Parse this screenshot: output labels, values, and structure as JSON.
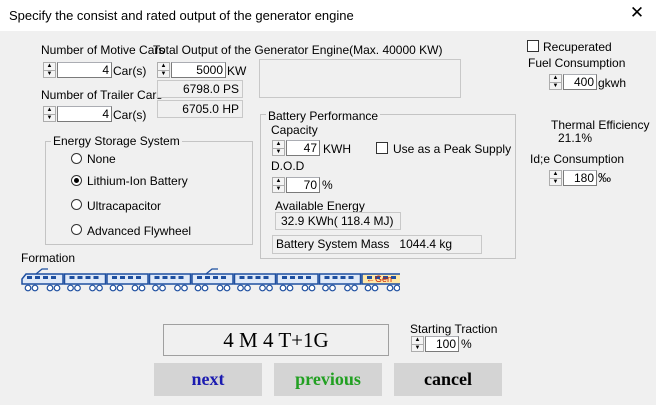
{
  "window": {
    "title": "Specify the consist and rated output of the generator engine",
    "close_glyph": "✕"
  },
  "motive": {
    "label": "Number of Motive Cars",
    "value": "4",
    "unit": "Car(s)"
  },
  "trailer": {
    "label": "Number of Trailer Cars",
    "value": "4",
    "unit": "Car(s)"
  },
  "output": {
    "label": "Total Output of the Generator Engine(Max. 40000 KW)",
    "value": "5000",
    "unit": "KW",
    "ps": "6798.0 PS",
    "hp": "6705.0 HP"
  },
  "recuperated": {
    "label": "Recuperated",
    "checked": false
  },
  "fuel": {
    "label": "Fuel Consumption",
    "value": "400",
    "unit": "gkwh"
  },
  "thermal": {
    "label": "Thermal Efficiency",
    "value": "21.1%"
  },
  "idle": {
    "label": "Id;e Consumption",
    "value": "180",
    "unit": "‰"
  },
  "storage": {
    "title": "Energy Storage System",
    "options": [
      {
        "label": "None",
        "selected": false
      },
      {
        "label": "Lithium-Ion Battery",
        "selected": true
      },
      {
        "label": "Ultracapacitor",
        "selected": false
      },
      {
        "label": "Advanced Flywheel",
        "selected": false
      }
    ]
  },
  "battery": {
    "title": "Battery Performance",
    "capacity_label": "Capacity",
    "capacity_value": "47",
    "capacity_unit": "KWH",
    "peak_label": "Use as a Peak Supply",
    "peak_checked": false,
    "dod_label": "D.O.D",
    "dod_value": "70",
    "dod_unit": "%",
    "available_label": "Available Energy",
    "available_value": "32.9 KWh( 118.4 MJ)",
    "mass_label": "Battery System Mass",
    "mass_value": "1044.4 kg"
  },
  "formation": {
    "label": "Formation",
    "gen_label": "Gen",
    "summary": "4 M 4 T+1G"
  },
  "traction": {
    "label": "Starting Traction",
    "value": "100",
    "unit": "%"
  },
  "buttons": {
    "next": "next",
    "previous": "previous",
    "cancel": "cancel"
  },
  "colors": {
    "car_stroke": "#1e4fa0",
    "car_fill": "#dfe9f8",
    "gen_fill": "#ffe8a8",
    "gen_text": "#cc2200",
    "next": "#1b1bb0",
    "previous": "#22a022",
    "cancel": "#000000",
    "btn_bg": "#d4d4d4"
  }
}
